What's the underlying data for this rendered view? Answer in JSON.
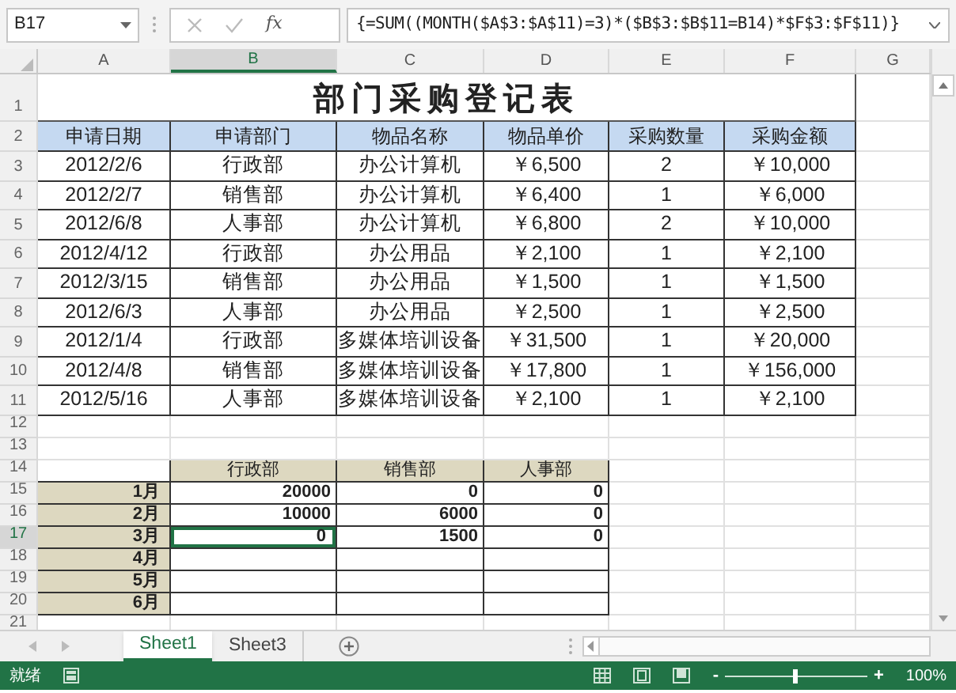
{
  "name_box": "B17",
  "function_button": "fx",
  "formula": "{=SUM((MONTH($A$3:$A$11)=3)*($B$3:$B$11=B14)*$F$3:$F$11)}",
  "columns": [
    {
      "label": "A",
      "selected": false
    },
    {
      "label": "B",
      "selected": true
    },
    {
      "label": "C",
      "selected": false
    },
    {
      "label": "D",
      "selected": false
    },
    {
      "label": "E",
      "selected": false
    },
    {
      "label": "F",
      "selected": false
    },
    {
      "label": "G",
      "selected": false
    }
  ],
  "row_headers": [
    {
      "label": "1",
      "selected": false
    },
    {
      "label": "2",
      "selected": false
    },
    {
      "label": "3",
      "selected": false
    },
    {
      "label": "4",
      "selected": false
    },
    {
      "label": "5",
      "selected": false
    },
    {
      "label": "6",
      "selected": false
    },
    {
      "label": "7",
      "selected": false
    },
    {
      "label": "8",
      "selected": false
    },
    {
      "label": "9",
      "selected": false
    },
    {
      "label": "10",
      "selected": false
    },
    {
      "label": "11",
      "selected": false
    },
    {
      "label": "12",
      "selected": false
    },
    {
      "label": "13",
      "selected": false
    },
    {
      "label": "14",
      "selected": false
    },
    {
      "label": "15",
      "selected": false
    },
    {
      "label": "16",
      "selected": false
    },
    {
      "label": "17",
      "selected": true
    },
    {
      "label": "18",
      "selected": false
    },
    {
      "label": "19",
      "selected": false
    },
    {
      "label": "20",
      "selected": false
    },
    {
      "label": "21",
      "selected": false
    }
  ],
  "title": "部门采购登记表",
  "table": {
    "columns": [
      "申请日期",
      "申请部门",
      "物品名称",
      "物品单价",
      "采购数量",
      "采购金额"
    ],
    "rows": [
      [
        "2012/2/6",
        "行政部",
        "办公计算机",
        "￥6,500",
        "2",
        "￥10,000"
      ],
      [
        "2012/2/7",
        "销售部",
        "办公计算机",
        "￥6,400",
        "1",
        "￥6,000"
      ],
      [
        "2012/6/8",
        "人事部",
        "办公计算机",
        "￥6,800",
        "2",
        "￥10,000"
      ],
      [
        "2012/4/12",
        "行政部",
        "办公用品",
        "￥2,100",
        "1",
        "￥2,100"
      ],
      [
        "2012/3/15",
        "销售部",
        "办公用品",
        "￥1,500",
        "1",
        "￥1,500"
      ],
      [
        "2012/6/3",
        "人事部",
        "办公用品",
        "￥2,500",
        "1",
        "￥2,500"
      ],
      [
        "2012/1/4",
        "行政部",
        "多媒体培训设备",
        "￥31,500",
        "1",
        "￥20,000"
      ],
      [
        "2012/4/8",
        "销售部",
        "多媒体培训设备",
        "￥17,800",
        "1",
        "￥156,000"
      ],
      [
        "2012/5/16",
        "人事部",
        "多媒体培训设备",
        "￥2,100",
        "1",
        "￥2,100"
      ]
    ]
  },
  "summary": {
    "columns": [
      "行政部",
      "销售部",
      "人事部"
    ],
    "rows": [
      {
        "label": "1月",
        "cells": [
          {
            "value": "20000",
            "selected": false
          },
          {
            "value": "0",
            "selected": false
          },
          {
            "value": "0",
            "selected": false
          }
        ]
      },
      {
        "label": "2月",
        "cells": [
          {
            "value": "10000",
            "selected": false
          },
          {
            "value": "6000",
            "selected": false
          },
          {
            "value": "0",
            "selected": false
          }
        ]
      },
      {
        "label": "3月",
        "cells": [
          {
            "value": "0",
            "selected": true
          },
          {
            "value": "1500",
            "selected": false
          },
          {
            "value": "0",
            "selected": false
          }
        ]
      },
      {
        "label": "4月"
      },
      {
        "label": "5月"
      },
      {
        "label": "6月"
      }
    ]
  },
  "sheet_tabs": [
    {
      "label": "Sheet1",
      "selected": true
    },
    {
      "label": "Sheet3",
      "selected": false
    }
  ],
  "status": "就绪",
  "zoom": {
    "minus": "-",
    "plus": "+",
    "level": 0.5,
    "reading": "100%"
  }
}
